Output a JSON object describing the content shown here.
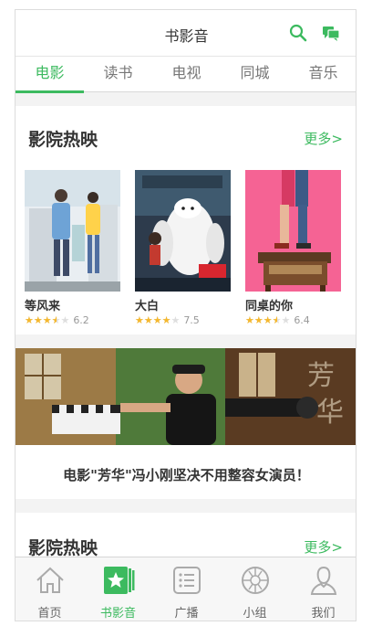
{
  "header": {
    "title": "书影音",
    "search_icon": "search-icon",
    "chat_icon": "chat-icon"
  },
  "tabs": [
    {
      "label": "电影",
      "active": true
    },
    {
      "label": "读书",
      "active": false
    },
    {
      "label": "电视",
      "active": false
    },
    {
      "label": "同城",
      "active": false
    },
    {
      "label": "音乐",
      "active": false
    }
  ],
  "section1": {
    "title": "影院热映",
    "more": "更多>",
    "movies": [
      {
        "name": "等风来",
        "score": "6.2",
        "stars": 3.5
      },
      {
        "name": "大白",
        "score": "7.5",
        "stars": 4
      },
      {
        "name": "同桌的你",
        "score": "6.4",
        "stars": 3.5
      }
    ]
  },
  "banner": {
    "headline": "电影\"芳华\"冯小刚坚决不用整容女演员！"
  },
  "section2": {
    "title": "影院热映",
    "more": "更多>"
  },
  "bottom_nav": [
    {
      "label": "首页",
      "icon": "home-icon",
      "active": false
    },
    {
      "label": "书影音",
      "icon": "book-media-icon",
      "active": true
    },
    {
      "label": "广播",
      "icon": "broadcast-icon",
      "active": false
    },
    {
      "label": "小组",
      "icon": "group-icon",
      "active": false
    },
    {
      "label": "我们",
      "icon": "profile-icon",
      "active": false
    }
  ],
  "colors": {
    "accent": "#3cba5f",
    "star": "#f5b82e"
  }
}
